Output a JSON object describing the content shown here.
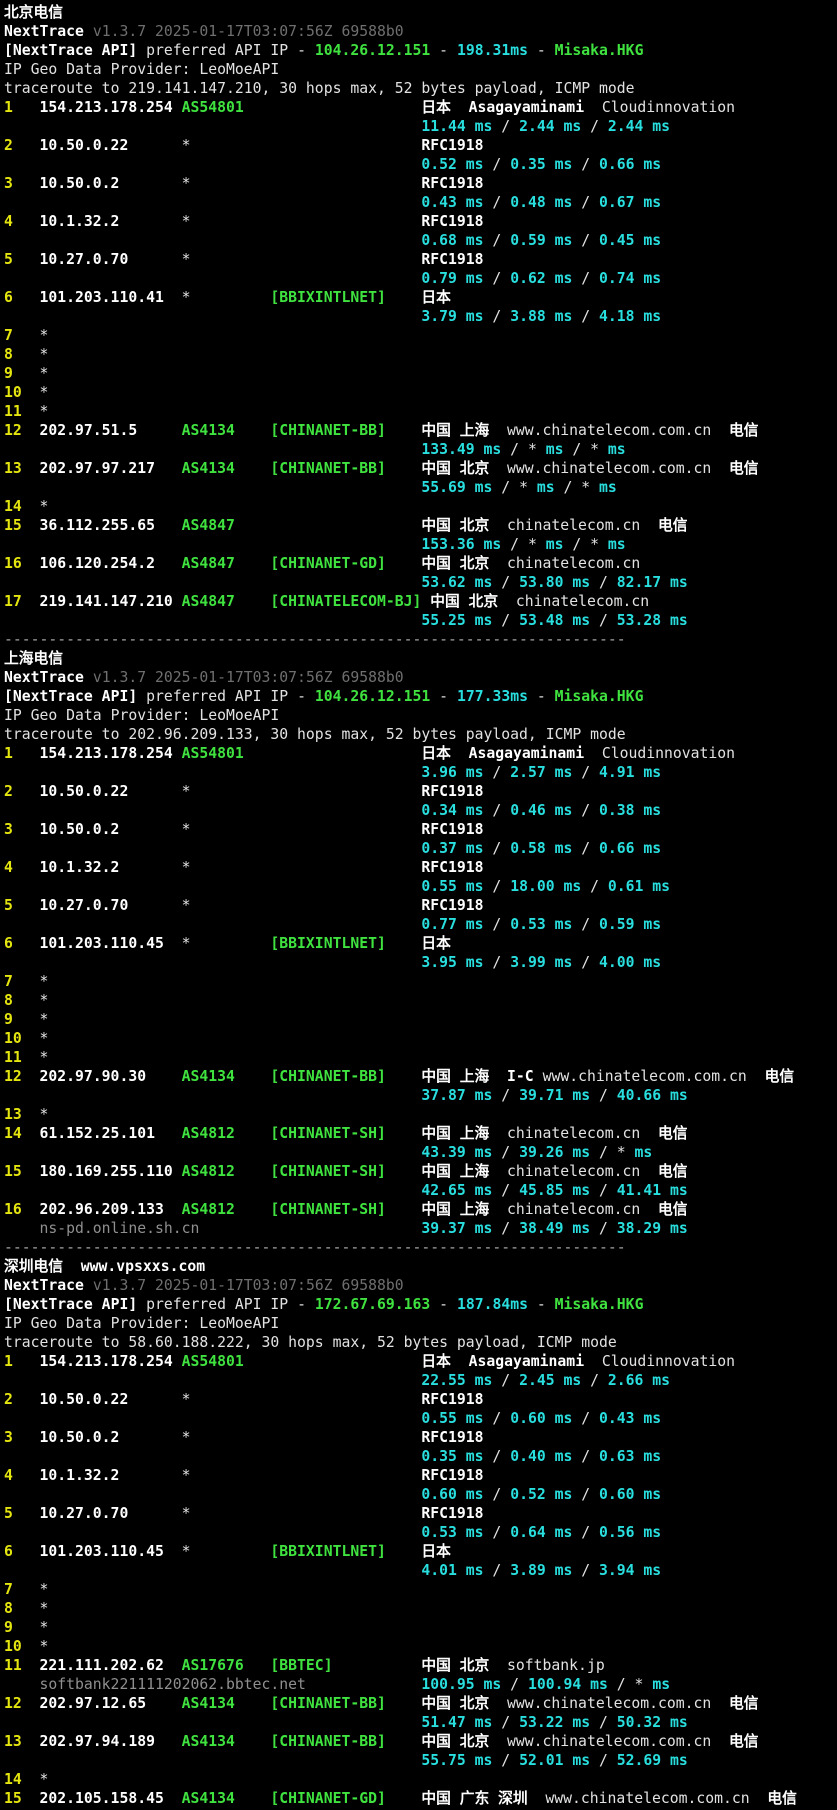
{
  "colors": {
    "background": "#000000",
    "text": "#e2e2e2",
    "bold_text": "#ffffff",
    "hop_number_yellow": "#e5e510",
    "asn_green": "#3fe23f",
    "latency_cyan": "#29dede",
    "version_gray": "#6f6f6f",
    "hostname_gray": "#8f8f8f"
  },
  "separator": "----------------------------------------------------------------------",
  "latency_separator": " / ",
  "latency_unit": "ms",
  "sections": [
    {
      "title": "北京电信",
      "watermark": null,
      "header": {
        "app": "NextTrace",
        "version": "v1.3.7 2025-01-17T03:07:56Z 69588b0",
        "api_prefix": "[NextTrace API]",
        "api_text": "preferred API IP",
        "api_ip": "104.26.12.151",
        "api_latency": "198.31ms",
        "api_node": "Misaka.HKG",
        "provider": "IP Geo Data Provider: LeoMoeAPI",
        "trace": "traceroute to 219.141.147.210, 30 hops max, 52 bytes payload, ICMP mode"
      },
      "hops": [
        {
          "n": 1,
          "ip": "154.213.178.254",
          "asn": "AS54801",
          "tag": null,
          "geo": [
            [
              "日本",
              "b",
              0
            ],
            [
              "Asagayaminami",
              "b",
              2
            ],
            [
              "Cloudinnovation",
              "n",
              2
            ]
          ],
          "lat": [
            "11.44",
            "2.44",
            "2.44"
          ],
          "host": null
        },
        {
          "n": 2,
          "ip": "10.50.0.22",
          "asn": "*",
          "tag": null,
          "geo": [
            [
              "RFC1918",
              "b",
              0
            ]
          ],
          "lat": [
            "0.52",
            "0.35",
            "0.66"
          ],
          "host": null
        },
        {
          "n": 3,
          "ip": "10.50.0.2",
          "asn": "*",
          "tag": null,
          "geo": [
            [
              "RFC1918",
              "b",
              0
            ]
          ],
          "lat": [
            "0.43",
            "0.48",
            "0.67"
          ],
          "host": null
        },
        {
          "n": 4,
          "ip": "10.1.32.2",
          "asn": "*",
          "tag": null,
          "geo": [
            [
              "RFC1918",
              "b",
              0
            ]
          ],
          "lat": [
            "0.68",
            "0.59",
            "0.45"
          ],
          "host": null
        },
        {
          "n": 5,
          "ip": "10.27.0.70",
          "asn": "*",
          "tag": null,
          "geo": [
            [
              "RFC1918",
              "b",
              0
            ]
          ],
          "lat": [
            "0.79",
            "0.62",
            "0.74"
          ],
          "host": null
        },
        {
          "n": 6,
          "ip": "101.203.110.41",
          "asn": "*",
          "tag": "[BBIXINTLNET]",
          "geo": [
            [
              "日本",
              "b",
              0
            ]
          ],
          "lat": [
            "3.79",
            "3.88",
            "4.18"
          ],
          "host": null
        },
        {
          "n": 7,
          "star": true
        },
        {
          "n": 8,
          "star": true
        },
        {
          "n": 9,
          "star": true
        },
        {
          "n": 10,
          "star": true
        },
        {
          "n": 11,
          "star": true
        },
        {
          "n": 12,
          "ip": "202.97.51.5",
          "asn": "AS4134",
          "tag": "[CHINANET-BB]",
          "geo": [
            [
              "中国 上海",
              "b",
              0
            ],
            [
              "www.chinatelecom.com.cn",
              "n",
              2
            ],
            [
              "电信",
              "b",
              2
            ]
          ],
          "lat": [
            "133.49",
            "*",
            "*"
          ],
          "host": null
        },
        {
          "n": 13,
          "ip": "202.97.97.217",
          "asn": "AS4134",
          "tag": "[CHINANET-BB]",
          "geo": [
            [
              "中国 北京",
              "b",
              0
            ],
            [
              "www.chinatelecom.com.cn",
              "n",
              2
            ],
            [
              "电信",
              "b",
              2
            ]
          ],
          "lat": [
            "55.69",
            "*",
            "*"
          ],
          "host": null
        },
        {
          "n": 14,
          "star": true
        },
        {
          "n": 15,
          "ip": "36.112.255.65",
          "asn": "AS4847",
          "tag": null,
          "geo": [
            [
              "中国 北京",
              "b",
              0
            ],
            [
              "chinatelecom.cn",
              "n",
              2
            ],
            [
              "电信",
              "b",
              2
            ]
          ],
          "lat": [
            "153.36",
            "*",
            "*"
          ],
          "host": null
        },
        {
          "n": 16,
          "ip": "106.120.254.2",
          "asn": "AS4847",
          "tag": "[CHINANET-GD]",
          "geo": [
            [
              "中国 北京",
              "b",
              0
            ],
            [
              "chinatelecom.cn",
              "n",
              2
            ]
          ],
          "lat": [
            "53.62",
            "53.80",
            "82.17"
          ],
          "host": null
        },
        {
          "n": 17,
          "ip": "219.141.147.210",
          "asn": "AS4847",
          "tag": "[CHINATELECOM-BJ]",
          "geo": [
            [
              "中国 北京",
              "b",
              0
            ],
            [
              "chinatelecom.cn",
              "n",
              2
            ]
          ],
          "lat": [
            "55.25",
            "53.48",
            "53.28"
          ],
          "host": null
        }
      ],
      "separator_after": true
    },
    {
      "title": "上海电信",
      "watermark": null,
      "header": {
        "app": "NextTrace",
        "version": "v1.3.7 2025-01-17T03:07:56Z 69588b0",
        "api_prefix": "[NextTrace API]",
        "api_text": "preferred API IP",
        "api_ip": "104.26.12.151",
        "api_latency": "177.33ms",
        "api_node": "Misaka.HKG",
        "provider": "IP Geo Data Provider: LeoMoeAPI",
        "trace": "traceroute to 202.96.209.133, 30 hops max, 52 bytes payload, ICMP mode"
      },
      "hops": [
        {
          "n": 1,
          "ip": "154.213.178.254",
          "asn": "AS54801",
          "tag": null,
          "geo": [
            [
              "日本",
              "b",
              0
            ],
            [
              "Asagayaminami",
              "b",
              2
            ],
            [
              "Cloudinnovation",
              "n",
              2
            ]
          ],
          "lat": [
            "3.96",
            "2.57",
            "4.91"
          ],
          "host": null
        },
        {
          "n": 2,
          "ip": "10.50.0.22",
          "asn": "*",
          "tag": null,
          "geo": [
            [
              "RFC1918",
              "b",
              0
            ]
          ],
          "lat": [
            "0.34",
            "0.46",
            "0.38"
          ],
          "host": null
        },
        {
          "n": 3,
          "ip": "10.50.0.2",
          "asn": "*",
          "tag": null,
          "geo": [
            [
              "RFC1918",
              "b",
              0
            ]
          ],
          "lat": [
            "0.37",
            "0.58",
            "0.66"
          ],
          "host": null
        },
        {
          "n": 4,
          "ip": "10.1.32.2",
          "asn": "*",
          "tag": null,
          "geo": [
            [
              "RFC1918",
              "b",
              0
            ]
          ],
          "lat": [
            "0.55",
            "18.00",
            "0.61"
          ],
          "host": null
        },
        {
          "n": 5,
          "ip": "10.27.0.70",
          "asn": "*",
          "tag": null,
          "geo": [
            [
              "RFC1918",
              "b",
              0
            ]
          ],
          "lat": [
            "0.77",
            "0.53",
            "0.59"
          ],
          "host": null
        },
        {
          "n": 6,
          "ip": "101.203.110.45",
          "asn": "*",
          "tag": "[BBIXINTLNET]",
          "geo": [
            [
              "日本",
              "b",
              0
            ]
          ],
          "lat": [
            "3.95",
            "3.99",
            "4.00"
          ],
          "host": null
        },
        {
          "n": 7,
          "star": true
        },
        {
          "n": 8,
          "star": true
        },
        {
          "n": 9,
          "star": true
        },
        {
          "n": 10,
          "star": true
        },
        {
          "n": 11,
          "star": true
        },
        {
          "n": 12,
          "ip": "202.97.90.30",
          "asn": "AS4134",
          "tag": "[CHINANET-BB]",
          "geo": [
            [
              "中国 上海",
              "b",
              0
            ],
            [
              "I-C",
              "b",
              2
            ],
            [
              "www.chinatelecom.com.cn",
              "n",
              1
            ],
            [
              "电信",
              "b",
              2
            ]
          ],
          "lat": [
            "37.87",
            "39.71",
            "40.66"
          ],
          "host": null
        },
        {
          "n": 13,
          "star": true
        },
        {
          "n": 14,
          "ip": "61.152.25.101",
          "asn": "AS4812",
          "tag": "[CHINANET-SH]",
          "geo": [
            [
              "中国 上海",
              "b",
              0
            ],
            [
              "chinatelecom.cn",
              "n",
              2
            ],
            [
              "电信",
              "b",
              2
            ]
          ],
          "lat": [
            "43.39",
            "39.26",
            "*"
          ],
          "host": null
        },
        {
          "n": 15,
          "ip": "180.169.255.110",
          "asn": "AS4812",
          "tag": "[CHINANET-SH]",
          "geo": [
            [
              "中国 上海",
              "b",
              0
            ],
            [
              "chinatelecom.cn",
              "n",
              2
            ],
            [
              "电信",
              "b",
              2
            ]
          ],
          "lat": [
            "42.65",
            "45.85",
            "41.41"
          ],
          "host": null
        },
        {
          "n": 16,
          "ip": "202.96.209.133",
          "asn": "AS4812",
          "tag": "[CHINANET-SH]",
          "geo": [
            [
              "中国 上海",
              "b",
              0
            ],
            [
              "chinatelecom.cn",
              "n",
              2
            ],
            [
              "电信",
              "b",
              2
            ]
          ],
          "lat": [
            "39.37",
            "38.49",
            "38.29"
          ],
          "host": "ns-pd.online.sh.cn"
        }
      ],
      "separator_after": true
    },
    {
      "title": "深圳电信",
      "watermark": "www.vpsxxs.com",
      "header": {
        "app": "NextTrace",
        "version": "v1.3.7 2025-01-17T03:07:56Z 69588b0",
        "api_prefix": "[NextTrace API]",
        "api_text": "preferred API IP",
        "api_ip": "172.67.69.163",
        "api_latency": "187.84ms",
        "api_node": "Misaka.HKG",
        "provider": "IP Geo Data Provider: LeoMoeAPI",
        "trace": "traceroute to 58.60.188.222, 30 hops max, 52 bytes payload, ICMP mode"
      },
      "hops": [
        {
          "n": 1,
          "ip": "154.213.178.254",
          "asn": "AS54801",
          "tag": null,
          "geo": [
            [
              "日本",
              "b",
              0
            ],
            [
              "Asagayaminami",
              "b",
              2
            ],
            [
              "Cloudinnovation",
              "n",
              2
            ]
          ],
          "lat": [
            "22.55",
            "2.45",
            "2.66"
          ],
          "host": null
        },
        {
          "n": 2,
          "ip": "10.50.0.22",
          "asn": "*",
          "tag": null,
          "geo": [
            [
              "RFC1918",
              "b",
              0
            ]
          ],
          "lat": [
            "0.55",
            "0.60",
            "0.43"
          ],
          "host": null
        },
        {
          "n": 3,
          "ip": "10.50.0.2",
          "asn": "*",
          "tag": null,
          "geo": [
            [
              "RFC1918",
              "b",
              0
            ]
          ],
          "lat": [
            "0.35",
            "0.40",
            "0.63"
          ],
          "host": null
        },
        {
          "n": 4,
          "ip": "10.1.32.2",
          "asn": "*",
          "tag": null,
          "geo": [
            [
              "RFC1918",
              "b",
              0
            ]
          ],
          "lat": [
            "0.60",
            "0.52",
            "0.60"
          ],
          "host": null
        },
        {
          "n": 5,
          "ip": "10.27.0.70",
          "asn": "*",
          "tag": null,
          "geo": [
            [
              "RFC1918",
              "b",
              0
            ]
          ],
          "lat": [
            "0.53",
            "0.64",
            "0.56"
          ],
          "host": null
        },
        {
          "n": 6,
          "ip": "101.203.110.45",
          "asn": "*",
          "tag": "[BBIXINTLNET]",
          "geo": [
            [
              "日本",
              "b",
              0
            ]
          ],
          "lat": [
            "4.01",
            "3.89",
            "3.94"
          ],
          "host": null
        },
        {
          "n": 7,
          "star": true
        },
        {
          "n": 8,
          "star": true
        },
        {
          "n": 9,
          "star": true
        },
        {
          "n": 10,
          "star": true
        },
        {
          "n": 11,
          "ip": "221.111.202.62",
          "asn": "AS17676",
          "tag": "[BBTEC]",
          "geo": [
            [
              "中国 北京",
              "b",
              0
            ],
            [
              "softbank.jp",
              "n",
              2
            ]
          ],
          "lat": [
            "100.95",
            "100.94",
            "*"
          ],
          "host": "softbank221111202062.bbtec.net"
        },
        {
          "n": 12,
          "ip": "202.97.12.65",
          "asn": "AS4134",
          "tag": "[CHINANET-BB]",
          "geo": [
            [
              "中国 北京",
              "b",
              0
            ],
            [
              "www.chinatelecom.com.cn",
              "n",
              2
            ],
            [
              "电信",
              "b",
              2
            ]
          ],
          "lat": [
            "51.47",
            "53.22",
            "50.32"
          ],
          "host": null
        },
        {
          "n": 13,
          "ip": "202.97.94.189",
          "asn": "AS4134",
          "tag": "[CHINANET-BB]",
          "geo": [
            [
              "中国 北京",
              "b",
              0
            ],
            [
              "www.chinatelecom.com.cn",
              "n",
              2
            ],
            [
              "电信",
              "b",
              2
            ]
          ],
          "lat": [
            "55.75",
            "52.01",
            "52.69"
          ],
          "host": null
        },
        {
          "n": 14,
          "star": true
        },
        {
          "n": 15,
          "ip": "202.105.158.45",
          "asn": "AS4134",
          "tag": "[CHINANET-GD]",
          "geo": [
            [
              "中国 广东 深圳",
              "b",
              0
            ],
            [
              "www.chinatelecom.com.cn",
              "n",
              2
            ],
            [
              "电信",
              "b",
              2
            ]
          ],
          "lat": null,
          "host": null
        }
      ],
      "separator_after": false
    }
  ]
}
